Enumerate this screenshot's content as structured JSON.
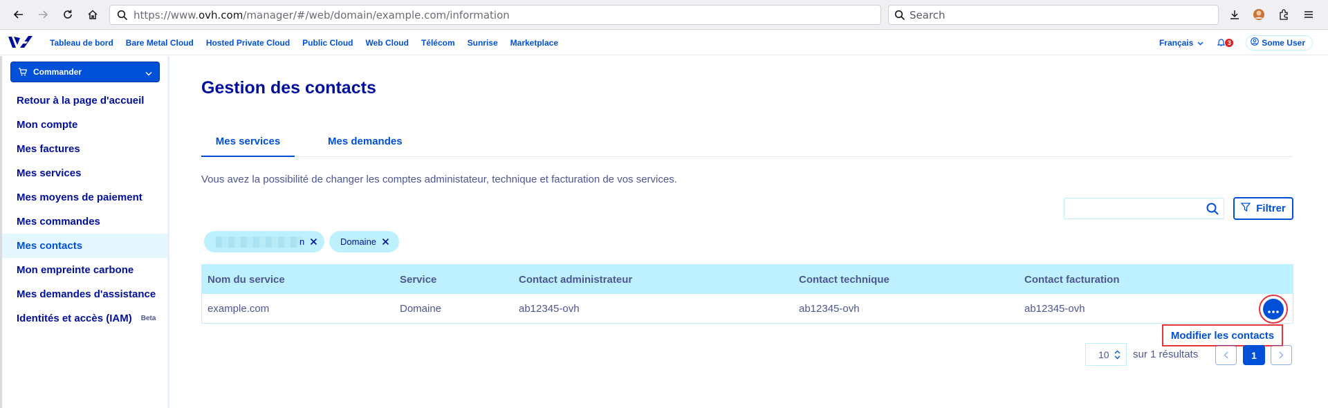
{
  "browser": {
    "url_prefix": "https://www.",
    "url_domain": "ovh.com",
    "url_suffix": "/manager/#/web/domain/example.com/information",
    "search_placeholder": "Search"
  },
  "topnav": {
    "links": [
      "Tableau de bord",
      "Bare Metal Cloud",
      "Hosted Private Cloud",
      "Public Cloud",
      "Web Cloud",
      "Télécom",
      "Sunrise",
      "Marketplace"
    ],
    "language": "Français",
    "notifications_count": "3",
    "user": "Some User"
  },
  "sidebar": {
    "order_button": "Commander",
    "items": [
      {
        "label": "Retour à la page d'accueil"
      },
      {
        "label": "Mon compte"
      },
      {
        "label": "Mes factures"
      },
      {
        "label": "Mes services"
      },
      {
        "label": "Mes moyens de paiement"
      },
      {
        "label": "Mes commandes"
      },
      {
        "label": "Mes contacts"
      },
      {
        "label": "Mon empreinte carbone"
      },
      {
        "label": "Mes demandes d'assistance"
      },
      {
        "label": "Identités et accès (IAM)"
      }
    ],
    "beta_badge": "Beta"
  },
  "main": {
    "title": "Gestion des contacts",
    "tabs": [
      {
        "label": "Mes services"
      },
      {
        "label": "Mes demandes"
      }
    ],
    "description": "Vous avez la possibilité de changer les comptes administateur, technique et facturation de vos services.",
    "filter_button": "Filtrer",
    "chips": [
      {
        "label": "n"
      },
      {
        "label": "Domaine"
      }
    ],
    "table": {
      "headers": [
        "Nom du service",
        "Service",
        "Contact administrateur",
        "Contact technique",
        "Contact facturation"
      ],
      "rows": [
        [
          "example.com",
          "Domaine",
          "ab12345-ovh",
          "ab12345-ovh",
          "ab12345-ovh"
        ]
      ]
    },
    "action_menu_item": "Modifier les contacts",
    "pagination": {
      "page_size": "10",
      "results_text": "sur 1 résultats",
      "current_page": "1"
    }
  },
  "colors": {
    "primary": "#0050d7",
    "title": "#000e9c",
    "text": "#4d5693",
    "header_bg": "#bef1ff",
    "highlight": "#e6323a"
  }
}
